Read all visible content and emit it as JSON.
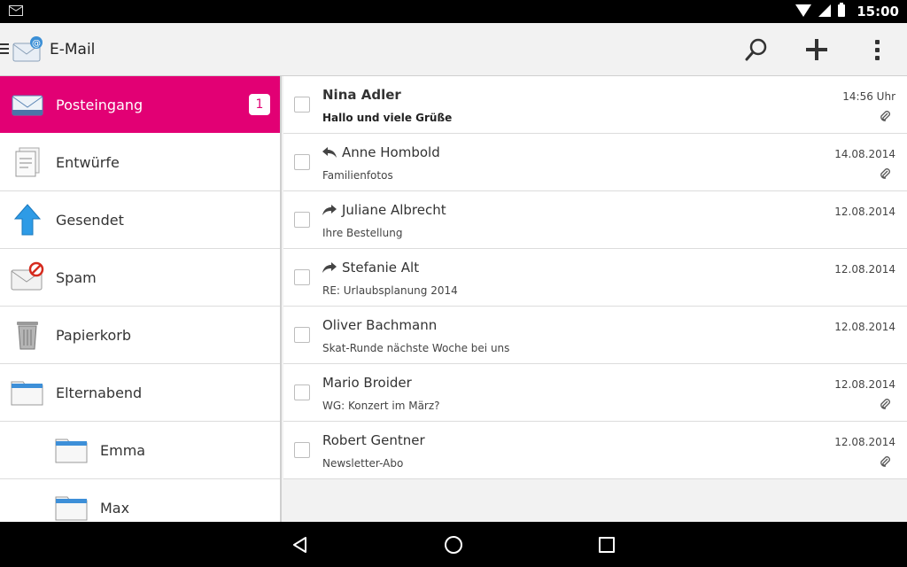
{
  "status_bar": {
    "time": "15:00"
  },
  "action_bar": {
    "title": "E-Mail",
    "icons": [
      "menu-icon",
      "mail-app-icon",
      "search-icon",
      "add-icon",
      "more-vertical-icon"
    ]
  },
  "sidebar": {
    "items": [
      {
        "label": "Posteingang",
        "icon": "inbox-icon",
        "badge": "1",
        "active": true
      },
      {
        "label": "Entwürfe",
        "icon": "drafts-icon"
      },
      {
        "label": "Gesendet",
        "icon": "sent-icon"
      },
      {
        "label": "Spam",
        "icon": "spam-icon"
      },
      {
        "label": "Papierkorb",
        "icon": "trash-icon"
      },
      {
        "label": "Elternabend",
        "icon": "folder-icon"
      },
      {
        "label": "Emma",
        "icon": "folder-icon",
        "indent": true
      },
      {
        "label": "Max",
        "icon": "folder-icon",
        "indent": true
      }
    ]
  },
  "messages": [
    {
      "sender": "Nina Adler",
      "subject": "Hallo und viele Grüße",
      "date": "14:56 Uhr",
      "unread": true,
      "attachment": true,
      "status": ""
    },
    {
      "sender": "Anne Hombold",
      "subject": "Familienfotos",
      "date": "14.08.2014",
      "attachment": true,
      "status": "replied"
    },
    {
      "sender": "Juliane Albrecht",
      "subject": "Ihre Bestellung",
      "date": "12.08.2014",
      "attachment": false,
      "status": "forwarded"
    },
    {
      "sender": "Stefanie Alt",
      "subject": "RE: Urlaubsplanung 2014",
      "date": "12.08.2014",
      "attachment": false,
      "status": "forwarded"
    },
    {
      "sender": "Oliver Bachmann",
      "subject": "Skat-Runde nächste Woche bei uns",
      "date": "12.08.2014",
      "attachment": false,
      "status": ""
    },
    {
      "sender": "Mario Broider",
      "subject": "WG: Konzert im März?",
      "date": "12.08.2014",
      "attachment": true,
      "status": ""
    },
    {
      "sender": "Robert Gentner",
      "subject": "Newsletter-Abo",
      "date": "12.08.2014",
      "attachment": true,
      "status": ""
    }
  ],
  "colors": {
    "accent": "#e20074",
    "background": "#f2f2f2"
  }
}
